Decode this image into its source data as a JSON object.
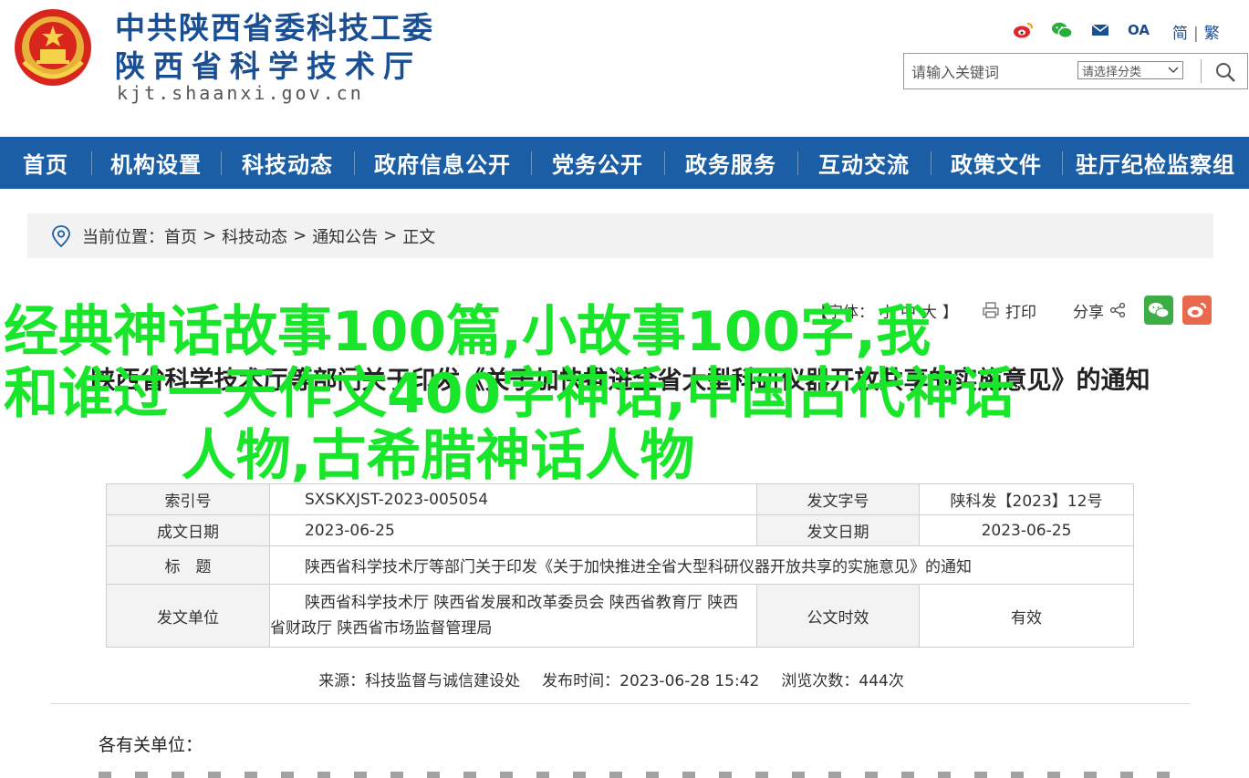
{
  "header": {
    "title_line1": "中共陕西省委科技工委",
    "title_line2": "陕西省科学技术厅",
    "domain": "kjt.shaanxi.gov.cn",
    "icons": [
      "weibo-icon",
      "wechat-icon",
      "mail-icon",
      "oa-icon"
    ],
    "oa_label": "OA",
    "lang_simplified": "简",
    "lang_sep": "|",
    "lang_traditional": "繁",
    "search": {
      "placeholder": "请输入关键词",
      "category_selected": "请选择分类"
    }
  },
  "nav": {
    "items": [
      "首页",
      "机构设置",
      "科技动态",
      "政府信息公开",
      "党务公开",
      "政务服务",
      "互动交流",
      "政策文件",
      "驻厅纪检监察组"
    ]
  },
  "breadcrumb": {
    "prefix": "当前位置：",
    "items": [
      "首页",
      "科技动态",
      "通知公告",
      "正文"
    ],
    "separator": ">"
  },
  "tools": {
    "font_label": "【字体：",
    "font_small": "小",
    "font_medium": "中",
    "font_large": "大",
    "font_close": "】",
    "print": "打印",
    "share": "分享"
  },
  "article": {
    "title": "陕西省科学技术厅等部门关于印发《关于加快推进全省大型科研仪器开放共享的实施意见》的通知"
  },
  "overlay": {
    "line1": "经典神话故事100篇,小故事100字,我",
    "line2": "和谁过一天作文400字神话,中国古代神话",
    "line3": "人物,古希腊神话人物"
  },
  "meta": {
    "index_label": "索引号",
    "index_value": "SXSKXJST-2023-005054",
    "doc_no_label": "发文字号",
    "doc_no_value": "陕科发【2023】12号",
    "created_label": "成文日期",
    "created_value": "2023-06-25",
    "issued_label": "发文日期",
    "issued_value": "2023-06-25",
    "title_label": "标　题",
    "title_value": "陕西省科学技术厅等部门关于印发《关于加快推进全省大型科研仪器开放共享的实施意见》的通知",
    "unit_label": "发文单位",
    "unit_value_line1": "陕西省科学技术厅 陕西省发展和改革委员会 陕西省教育厅 陕西",
    "unit_value_line2": "省财政厅 陕西省市场监督管理局",
    "validity_label": "公文时效",
    "validity_value": "有效"
  },
  "source": {
    "from": "来源：科技监督与诚信建设处",
    "published": "发布时间：2023-06-28 15:42",
    "views": "浏览次数：444次"
  },
  "body": {
    "greeting": "各有关单位："
  }
}
